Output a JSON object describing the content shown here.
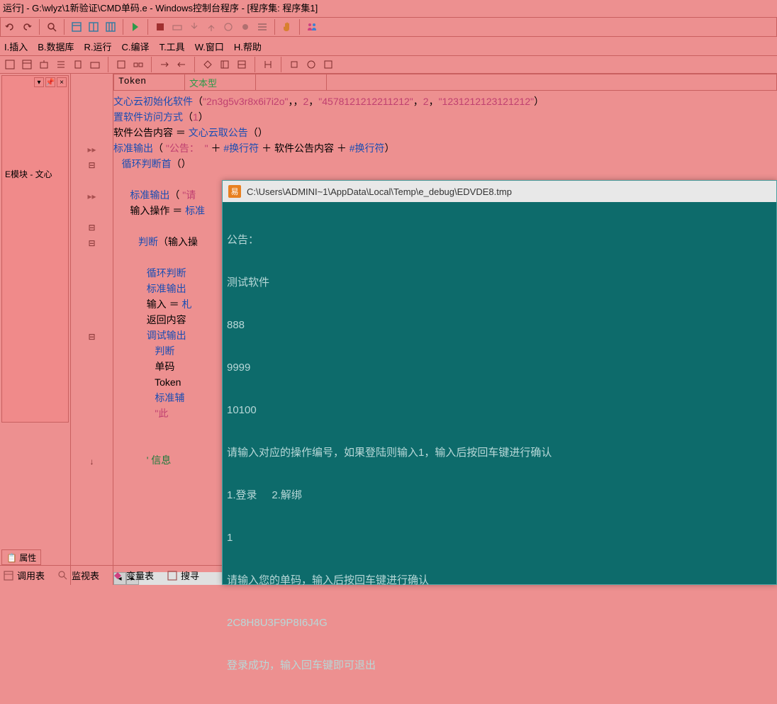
{
  "window": {
    "title": "运行] - G:\\wlyz\\1新验证\\CMD单码.e - Windows控制台程序 - [程序集: 程序集1]"
  },
  "menu": {
    "items": [
      "I.插入",
      "B.数据库",
      "R.运行",
      "C.编译",
      "T.工具",
      "W.窗口",
      "H.帮助"
    ]
  },
  "sidebar": {
    "module_label": "E模块 - 文心",
    "tab_props": "属性"
  },
  "varrow": {
    "name": "Token",
    "type": "文本型"
  },
  "code": {
    "l1_a": "文心云初始化软件",
    "l1_b": "（",
    "l1_c": "\"2n3g5v3r8x6i7i2o\"",
    "l1_d": "，，",
    "l1_e": "2",
    "l1_f": "，",
    "l1_g": "\"4578121212211212\"",
    "l1_h": "，",
    "l1_i": "2",
    "l1_j": "，",
    "l1_k": "\"1231212123121212\"",
    "l1_l": "）",
    "l2_a": "置软件访问方式",
    "l2_b": "（",
    "l2_c": "1",
    "l2_d": "）",
    "l3_a": "软件公告内容 ",
    "l3_b": "＝",
    "l3_c": " 文心云取公告",
    "l3_d": "（）",
    "l4_a": "标准输出",
    "l4_b": "（ ",
    "l4_c": "\"公告：  \"",
    "l4_d": " ＋ ",
    "l4_e": "#换行符",
    "l4_f": " ＋ 软件公告内容 ＋ ",
    "l4_g": "#换行符",
    "l4_h": "）",
    "l5": "循环判断首",
    "l5_b": "（）",
    "l6_a": "标准输出",
    "l6_b": "（ ",
    "l6_c": "\"请",
    "l7_a": "输入操作 ",
    "l7_b": "＝",
    "l7_c": " 标准",
    "l8_a": "判断",
    "l8_b": "（输入操",
    "l9": "循环判断",
    "l10": "标准输出",
    "l11_a": "输入 ",
    "l11_b": "＝",
    "l11_c": " 札",
    "l12": "返回内容",
    "l13": "调试输出",
    "l14": "判断",
    "l15": "单码",
    "l16": "Token",
    "l17": "标准辅",
    "l18": "\"此",
    "l19": "' 信息"
  },
  "console": {
    "title": "C:\\Users\\ADMINI~1\\AppData\\Local\\Temp\\e_debug\\EDVDE8.tmp",
    "lines": [
      "公告：",
      "测试软件",
      "888",
      "9999",
      "10100",
      "请输入对应的操作编号，如果登陆则输入1，输入后按回车键进行确认",
      "1.登录     2.解绑",
      "1",
      "请输入您的单码，输入后按回车键进行确认",
      "2C8H8U3F9P8I6J4G",
      "登录成功，输入回车键即可退出"
    ]
  },
  "bottombar": {
    "items": [
      "调用表",
      "监视表",
      "变量表",
      "搜寻"
    ]
  }
}
